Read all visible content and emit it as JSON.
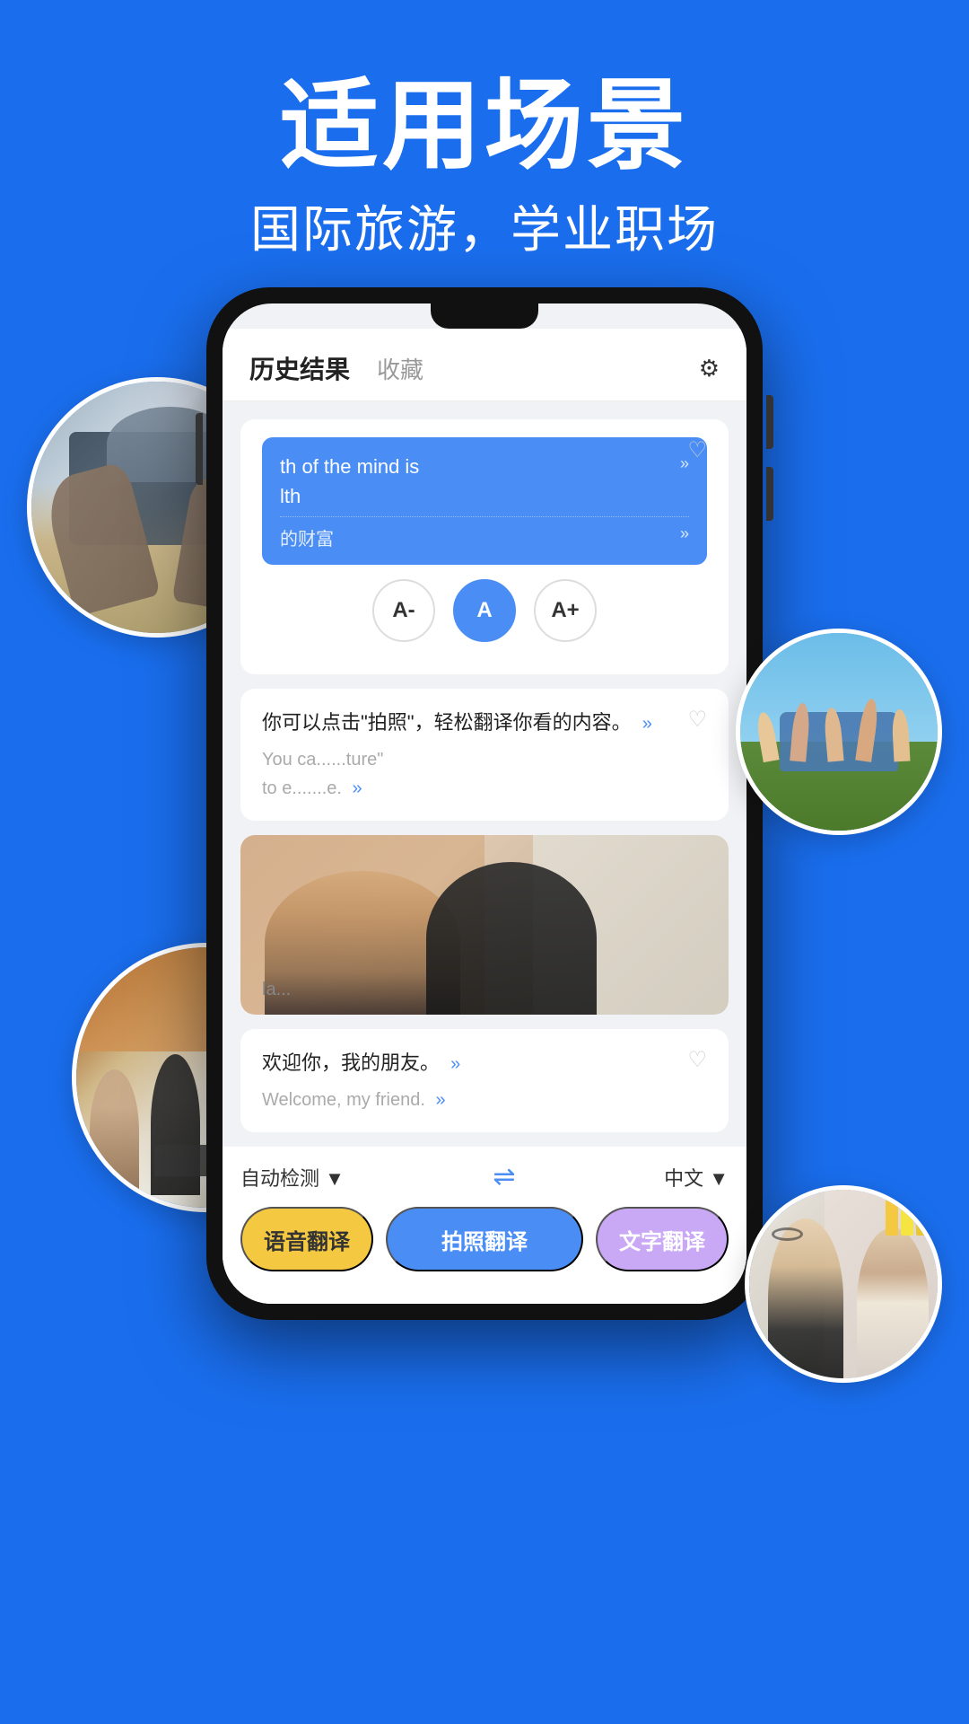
{
  "header": {
    "main_title": "适用场景",
    "sub_title": "国际旅游，学业职场"
  },
  "nav": {
    "history_label": "历史结果",
    "favorites_label": "收藏",
    "settings_icon": "⚙"
  },
  "font_size_buttons": [
    {
      "label": "A-",
      "active": false
    },
    {
      "label": "A",
      "active": true
    },
    {
      "label": "A+",
      "active": false
    }
  ],
  "translation_card_1": {
    "blue_text_1": "th of the mind is",
    "blue_text_2": "lth",
    "zh_translation": "的财富"
  },
  "translation_card_2": {
    "zh_text": "你可以点击\"拍照\"，轻松翻译你看的内容。",
    "en_text": "You ca......ture\"\nto e.......e."
  },
  "translation_card_3": {
    "placeholder": ""
  },
  "translation_card_4": {
    "zh_text": "欢迎你，我的朋友。",
    "en_text": "Welcome, my friend."
  },
  "bottom_controls": {
    "source_lang": "自动检测 ▼",
    "swap_icon": "⇌",
    "target_lang": "中文 ▼"
  },
  "action_buttons": {
    "voice": "语音翻译",
    "photo": "拍照翻译",
    "text": "文字翻译"
  },
  "colors": {
    "bg_blue": "#1a6eee",
    "btn_blue": "#4a8ef5",
    "btn_yellow": "#f5c842",
    "btn_purple": "#c9a8f5"
  },
  "circles": [
    {
      "id": "circle-1",
      "desc": "hands writing on tablet",
      "pos": "top-left"
    },
    {
      "id": "circle-2",
      "desc": "young people jumping",
      "pos": "top-right"
    },
    {
      "id": "circle-3",
      "desc": "students in classroom with laptops",
      "pos": "middle-left"
    },
    {
      "id": "circle-4",
      "desc": "students studying together",
      "pos": "bottom-right"
    }
  ]
}
